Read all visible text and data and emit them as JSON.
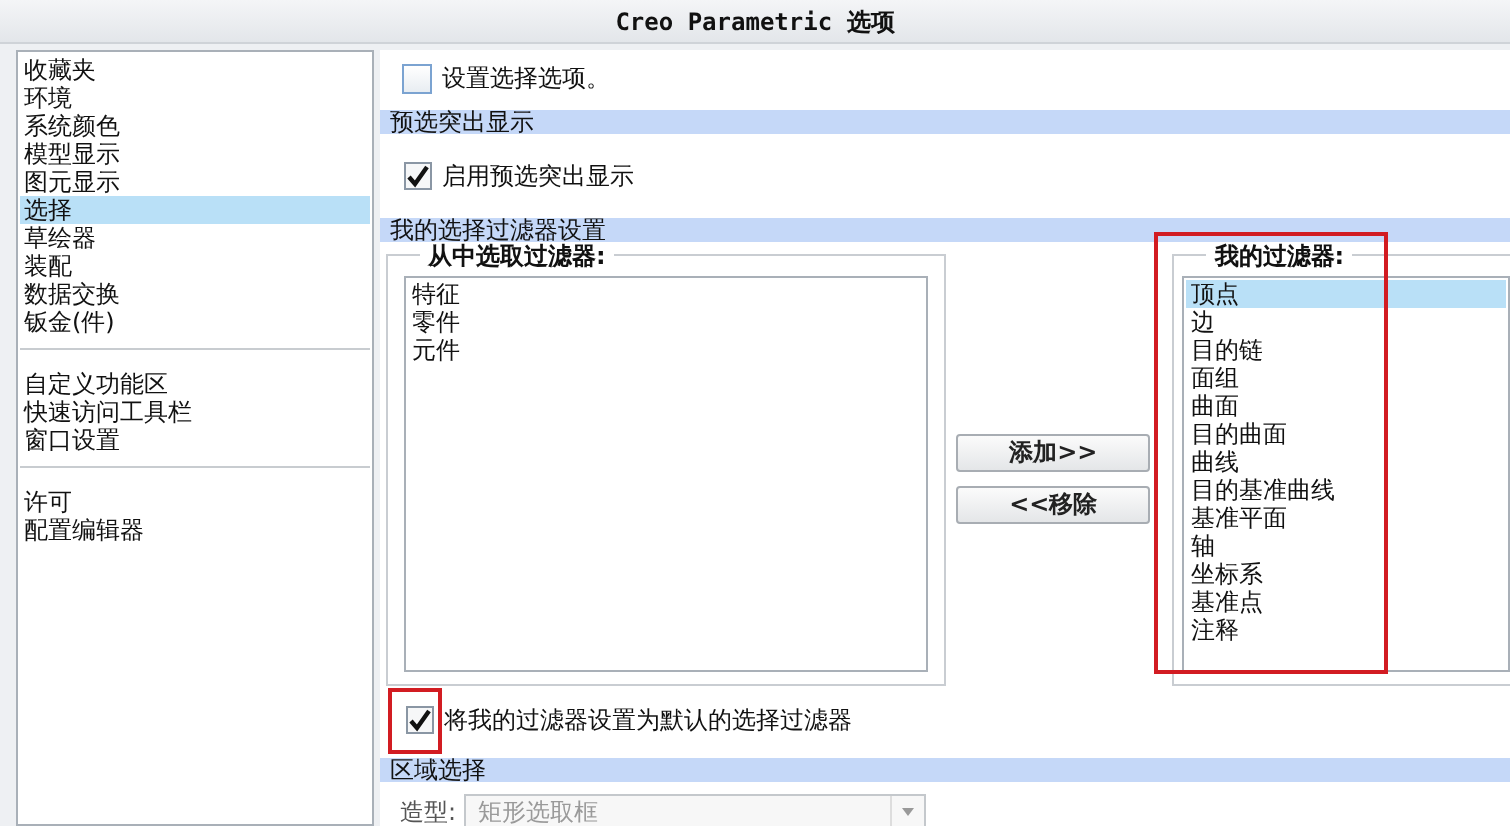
{
  "window": {
    "title": "Creo Parametric 选项"
  },
  "sidebar": {
    "groups": [
      {
        "items": [
          {
            "label": "收藏夹",
            "selected": false
          },
          {
            "label": "环境",
            "selected": false
          },
          {
            "label": "系统颜色",
            "selected": false
          },
          {
            "label": "模型显示",
            "selected": false
          },
          {
            "label": "图元显示",
            "selected": false
          },
          {
            "label": "选择",
            "selected": true
          },
          {
            "label": "草绘器",
            "selected": false
          },
          {
            "label": "装配",
            "selected": false
          },
          {
            "label": "数据交换",
            "selected": false
          },
          {
            "label": "钣金(件)",
            "selected": false
          }
        ]
      },
      {
        "items": [
          {
            "label": "自定义功能区",
            "selected": false
          },
          {
            "label": "快速访问工具栏",
            "selected": false
          },
          {
            "label": "窗口设置",
            "selected": false
          }
        ]
      },
      {
        "items": [
          {
            "label": "许可",
            "selected": false
          },
          {
            "label": "配置编辑器",
            "selected": false
          }
        ]
      }
    ]
  },
  "intro": {
    "label": "设置选择选项。",
    "checked": false
  },
  "preselection": {
    "heading": "预选突出显示",
    "option": {
      "label": "启用预选突出显示",
      "checked": true
    }
  },
  "filters": {
    "heading": "我的选择过滤器设置",
    "available": {
      "legend": "从中选取过滤器:",
      "items": [
        {
          "label": "特征",
          "selected": false
        },
        {
          "label": "零件",
          "selected": false
        },
        {
          "label": "元件",
          "selected": false
        }
      ]
    },
    "add_button": "添加>>",
    "remove_button": "<<移除",
    "mine": {
      "legend": "我的过滤器:",
      "annotated": true,
      "items": [
        {
          "label": "顶点",
          "selected": true
        },
        {
          "label": "边",
          "selected": false
        },
        {
          "label": "目的链",
          "selected": false
        },
        {
          "label": "面组",
          "selected": false
        },
        {
          "label": "曲面",
          "selected": false
        },
        {
          "label": "目的曲面",
          "selected": false
        },
        {
          "label": "曲线",
          "selected": false
        },
        {
          "label": "目的基准曲线",
          "selected": false
        },
        {
          "label": "基准平面",
          "selected": false
        },
        {
          "label": "轴",
          "selected": false
        },
        {
          "label": "坐标系",
          "selected": false
        },
        {
          "label": "基准点",
          "selected": false
        },
        {
          "label": "注释",
          "selected": false
        }
      ]
    },
    "default_option": {
      "label": "将我的过滤器设置为默认的选择过滤器",
      "checked": true,
      "annotated": true
    }
  },
  "area_selection": {
    "heading": "区域选择",
    "shape_label": "造型:",
    "shape_value": "矩形选取框",
    "disabled": true
  }
}
